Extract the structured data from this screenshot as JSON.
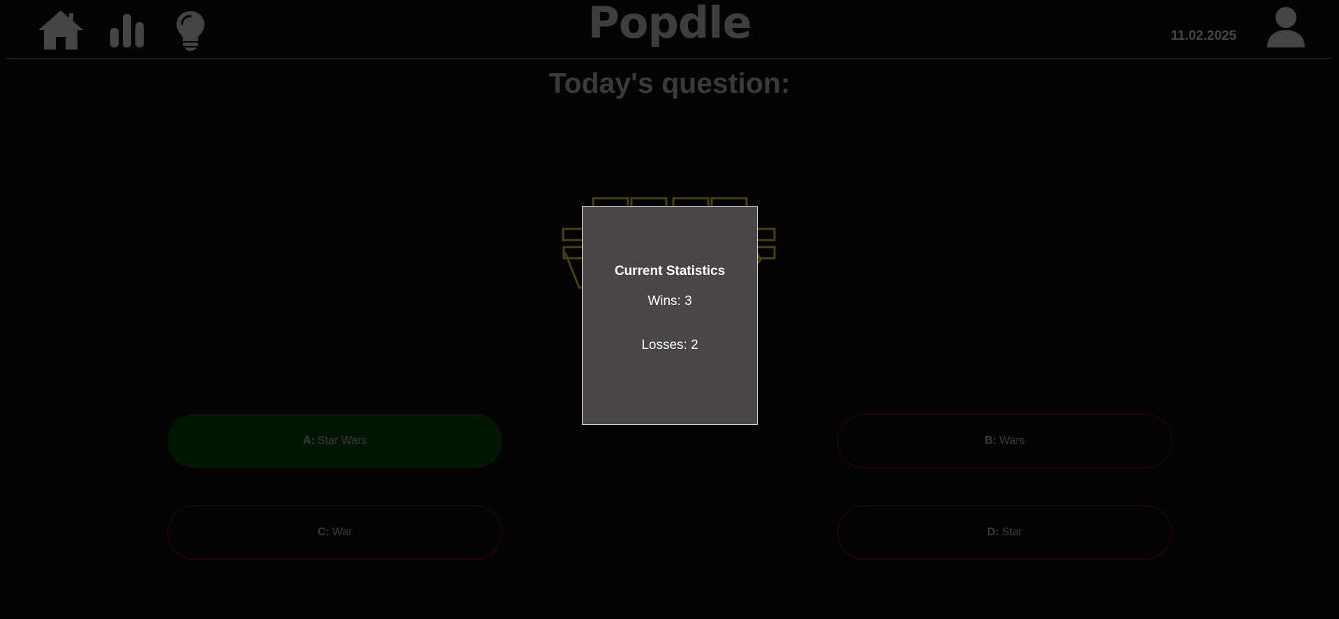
{
  "header": {
    "app_title": "Popdle",
    "date": "11.02.2025",
    "icons": [
      "home-icon",
      "bar-chart-icon",
      "lightbulb-icon",
      "user-profile-icon"
    ]
  },
  "main": {
    "question_heading": "Today's question:",
    "question_image": "star-wars-logo"
  },
  "answers": [
    {
      "letter": "A:",
      "text": "Star Wars",
      "state": "correct"
    },
    {
      "letter": "B:",
      "text": "Wars",
      "state": "wrong"
    },
    {
      "letter": "C:",
      "text": "War",
      "state": "wrong"
    },
    {
      "letter": "D:",
      "text": "Star",
      "state": "wrong"
    }
  ],
  "stats_modal": {
    "title": "Current Statistics",
    "wins": "Wins: 3",
    "losses": "Losses: 2"
  },
  "colors": {
    "background": "#030303",
    "header_dim": "#3e3e3e",
    "modal_bg": "#4a4646",
    "modal_border": "#dcdcdc",
    "correct_fill": "#031503",
    "wrong_border": "#3a0505",
    "logo_outline": "#4a4010"
  }
}
